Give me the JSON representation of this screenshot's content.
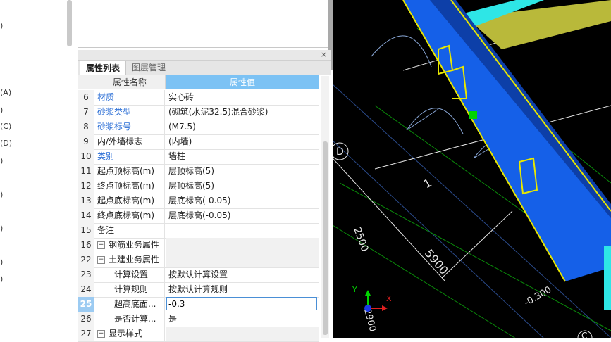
{
  "tree": {
    "fragments": [
      ")",
      "(A)",
      ")",
      "(C)",
      "(D)",
      ")",
      ")",
      ")",
      ")",
      ")"
    ]
  },
  "panel": {
    "close_glyph": "×"
  },
  "tabs": [
    {
      "label": "属性列表"
    },
    {
      "label": "图层管理"
    }
  ],
  "grid": {
    "headers": {
      "name": "属性名称",
      "value": "属性值"
    },
    "rows": [
      {
        "num": "6",
        "name": "材质",
        "value": "实心砖"
      },
      {
        "num": "7",
        "name": "砂浆类型",
        "value": "(砌筑(水泥32.5)混合砂浆)"
      },
      {
        "num": "8",
        "name": "砂浆标号",
        "value": "(M7.5)"
      },
      {
        "num": "9",
        "name": "内/外墙标志",
        "value": "(内墙)"
      },
      {
        "num": "10",
        "name": "类别",
        "value": "墙柱"
      },
      {
        "num": "11",
        "name": "起点顶标高(m)",
        "value": "层顶标高(5)"
      },
      {
        "num": "12",
        "name": "终点顶标高(m)",
        "value": "层顶标高(5)"
      },
      {
        "num": "13",
        "name": "起点底标高(m)",
        "value": "层底标高(-0.05)"
      },
      {
        "num": "14",
        "name": "终点底标高(m)",
        "value": "层底标高(-0.05)"
      },
      {
        "num": "15",
        "name": "备注",
        "value": ""
      },
      {
        "num": "16",
        "name": "钢筋业务属性",
        "value": "",
        "expander": "+"
      },
      {
        "num": "22",
        "name": "土建业务属性",
        "value": "",
        "expander": "−"
      },
      {
        "num": "23",
        "name": "计算设置",
        "value": "按默认计算设置"
      },
      {
        "num": "24",
        "name": "计算规则",
        "value": "按默认计算规则"
      },
      {
        "num": "25",
        "name": "超高底面...",
        "value": "-0.3"
      },
      {
        "num": "26",
        "name": "是否计算...",
        "value": "是"
      },
      {
        "num": "27",
        "name": "显示样式",
        "value": "",
        "expander": "+"
      }
    ]
  },
  "cad": {
    "axis_label": "D",
    "dim_5900": "5900",
    "dim_2500": "2500",
    "label_1": "1",
    "elev": "-0.300",
    "dim_bottom": "2900",
    "corner_label": "C",
    "axis_x": "X",
    "axis_y": "Y",
    "colors": {
      "wall_blue": "#1560e8",
      "wall_outline": "#e8e800",
      "beam_yellow": "#c8c832",
      "cyan": "#2ee6e6",
      "marker_green": "#00d400"
    }
  }
}
